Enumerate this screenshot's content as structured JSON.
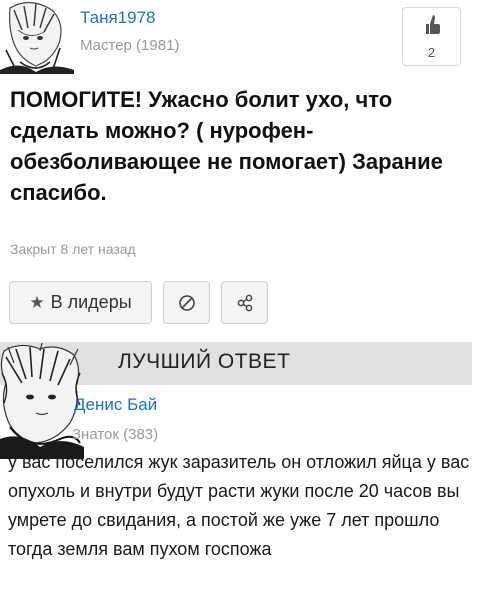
{
  "question": {
    "author": {
      "name": "Таня1978",
      "rank": "Мастер (1981)"
    },
    "likes": "2",
    "title": "ПОМОГИТЕ! Ужасно болит ухо, что сделать можно? ( нурофен-обезболивающее не помогает) Зарание спасибо.",
    "closed_meta": "Закрыт 8 лет назад"
  },
  "actions": {
    "leaders_label": "В лидеры",
    "leaders_icon": "star-icon",
    "report_icon": "block-icon",
    "share_icon": "share-icon"
  },
  "best_answer": {
    "section_title": "ЛУЧШИЙ ОТВЕТ",
    "author": {
      "name": "Денис Бай",
      "rank": "Знаток (383)"
    },
    "text": "у вас поселился жук заразитель он отложил яйца у вас опухоль и внутри будут расти жуки после 20 часов вы умрете до свидания, а постой же уже 7 лет прошло тогда земля вам пухом госпожа"
  },
  "colors": {
    "link": "#1a73c8",
    "meta": "#999999",
    "band": "#e1e1e1"
  }
}
